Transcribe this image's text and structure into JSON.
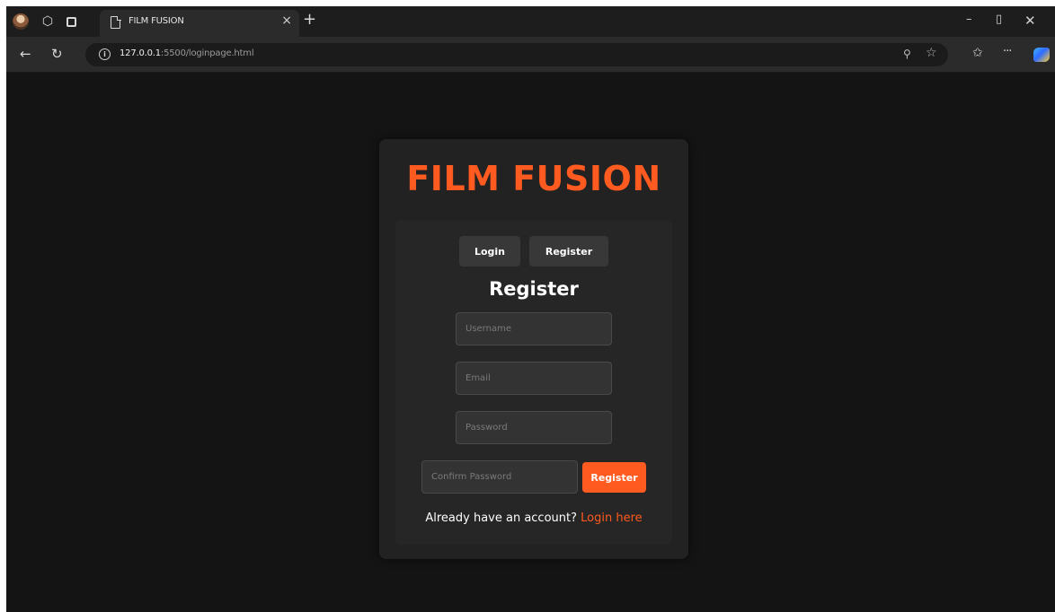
{
  "browser": {
    "tab_title": "FILM FUSION",
    "tab_close": "×",
    "new_tab": "+",
    "url_host": "127.0.0.1",
    "url_rest": ":5500/loginpage.html",
    "icons": [
      "profile-icon",
      "workspaces-icon",
      "tab-actions-icon",
      "page-icon",
      "back-icon",
      "refresh-icon",
      "info-icon",
      "key-icon",
      "star-icon",
      "favorites-icon",
      "more-icon",
      "copilot-icon",
      "minimize-icon",
      "maximize-icon",
      "close-icon"
    ]
  },
  "page": {
    "brand": "FILM FUSION",
    "tabs": {
      "login": "Login",
      "register": "Register"
    },
    "form_title": "Register",
    "fields": {
      "username_placeholder": "Username",
      "email_placeholder": "Email",
      "password_placeholder": "Password",
      "confirm_placeholder": "Confirm Password"
    },
    "submit_label": "Register",
    "switch_text": "Already have an account?",
    "switch_link": "Login here"
  },
  "colors": {
    "accent": "#ff5a1f",
    "background": "#141414",
    "card": "#222222"
  }
}
